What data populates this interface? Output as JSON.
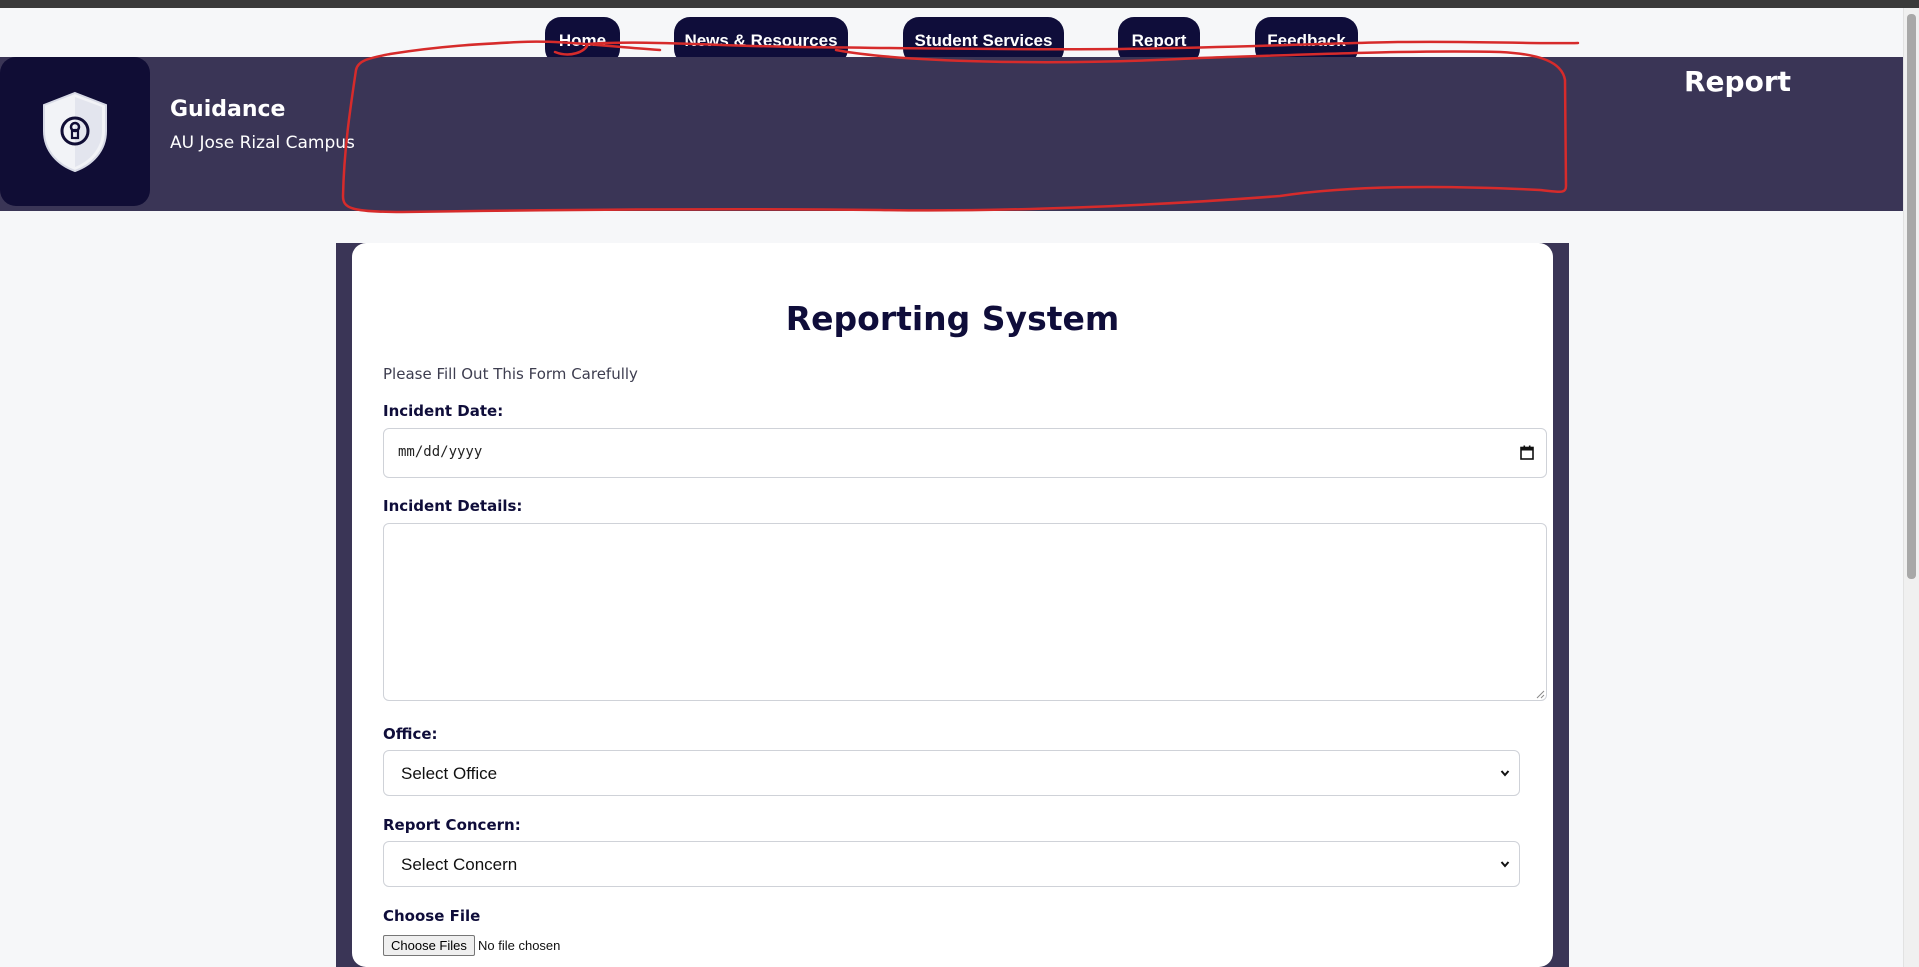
{
  "nav": {
    "items": [
      {
        "label": "Home"
      },
      {
        "label": "News & Resources"
      },
      {
        "label": "Student Services"
      },
      {
        "label": "Report"
      },
      {
        "label": "Feedback"
      }
    ]
  },
  "header": {
    "logo_icon": "shield-keyhole-icon",
    "title": "Guidance",
    "subtitle": "AU Jose Rizal Campus",
    "page_label": "Report"
  },
  "form": {
    "title": "Reporting System",
    "note": "Please Fill Out This Form Carefully",
    "incident_date_label": "Incident Date:",
    "incident_date_placeholder": "mm/dd/yyyy",
    "incident_details_label": "Incident Details:",
    "incident_details_value": "",
    "office_label": "Office:",
    "office_selected": "Select Office",
    "concern_label": "Report Concern:",
    "concern_selected": "Select Concern",
    "file_label": "Choose File",
    "file_button": "Choose Files",
    "file_status": "No file chosen"
  },
  "colors": {
    "nav_button": "#0f0d3a",
    "header_bg": "#3a3556",
    "logo_bg": "#100d35",
    "annotation": "#d62b2b"
  }
}
